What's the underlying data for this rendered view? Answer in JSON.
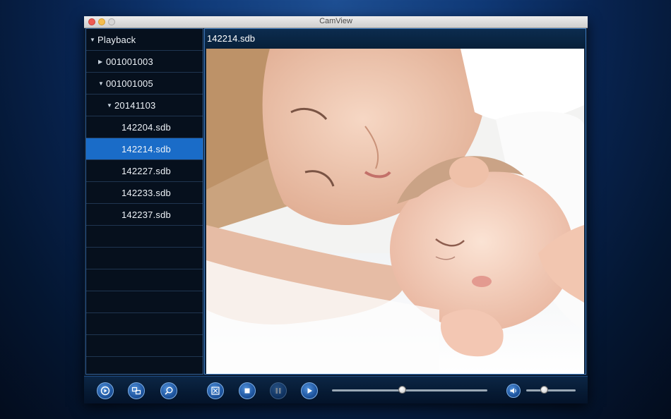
{
  "window": {
    "title": "CamView"
  },
  "sidebar": {
    "items": [
      {
        "label": "Playback",
        "expander": "down",
        "level": 0,
        "selected": false
      },
      {
        "label": "001001003",
        "expander": "right",
        "level": 1,
        "selected": false
      },
      {
        "label": "001001005",
        "expander": "down",
        "level": 1,
        "selected": false
      },
      {
        "label": "20141103",
        "expander": "down",
        "level": 2,
        "selected": false
      },
      {
        "label": "142204.sdb",
        "expander": "none",
        "level": 3,
        "selected": false
      },
      {
        "label": "142214.sdb",
        "expander": "none",
        "level": 3,
        "selected": true
      },
      {
        "label": "142227.sdb",
        "expander": "none",
        "level": 3,
        "selected": false
      },
      {
        "label": "142233.sdb",
        "expander": "none",
        "level": 3,
        "selected": false
      },
      {
        "label": "142237.sdb",
        "expander": "none",
        "level": 3,
        "selected": false
      }
    ],
    "empty_rows": 7
  },
  "player": {
    "current_file": "142214.sdb",
    "progress": 0.45,
    "volume": 0.37
  },
  "controls": {
    "buttons": [
      {
        "name": "playback-mode-icon"
      },
      {
        "name": "camera-list-icon"
      },
      {
        "name": "search-icon"
      },
      {
        "name": "fullscreen-icon"
      },
      {
        "name": "stop-icon"
      },
      {
        "name": "pause-icon",
        "disabled": true
      },
      {
        "name": "play-icon"
      }
    ],
    "volume_icon": "speaker-icon"
  },
  "colors": {
    "selection": "#1a6cc8",
    "accent": "#3d7ac0",
    "background": "#082451"
  }
}
